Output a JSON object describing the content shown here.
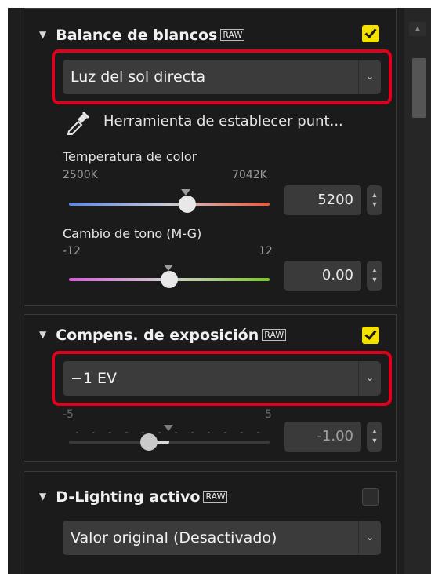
{
  "white_balance": {
    "title": "Balance de blancos",
    "raw_badge": "RAW",
    "enabled": true,
    "preset_value": "Luz del sol directa",
    "tool_label": "Herramienta de establecer punt...",
    "icon": "eyedropper-icon",
    "temperature": {
      "label": "Temperatura de color",
      "min": "2500K",
      "max": "7042K",
      "value": "5200",
      "level": 0.59
    },
    "tint": {
      "label": "Cambio de tono (M-G)",
      "min": "-12",
      "max": "12",
      "value": "0.00",
      "level": 0.5
    }
  },
  "exposure": {
    "title": "Compens. de exposición",
    "raw_badge": "RAW",
    "enabled": true,
    "preset_value": "−1 EV",
    "min": "-5",
    "max": "5",
    "value": "-1.00",
    "level": 0.4
  },
  "active_dlighting": {
    "title": "D-Lighting activo",
    "raw_badge": "RAW",
    "enabled": false,
    "preset_value": "Valor original (Desactivado)"
  },
  "colors": {
    "highlight": "#e0001b",
    "checkbox": "#f4e100"
  }
}
